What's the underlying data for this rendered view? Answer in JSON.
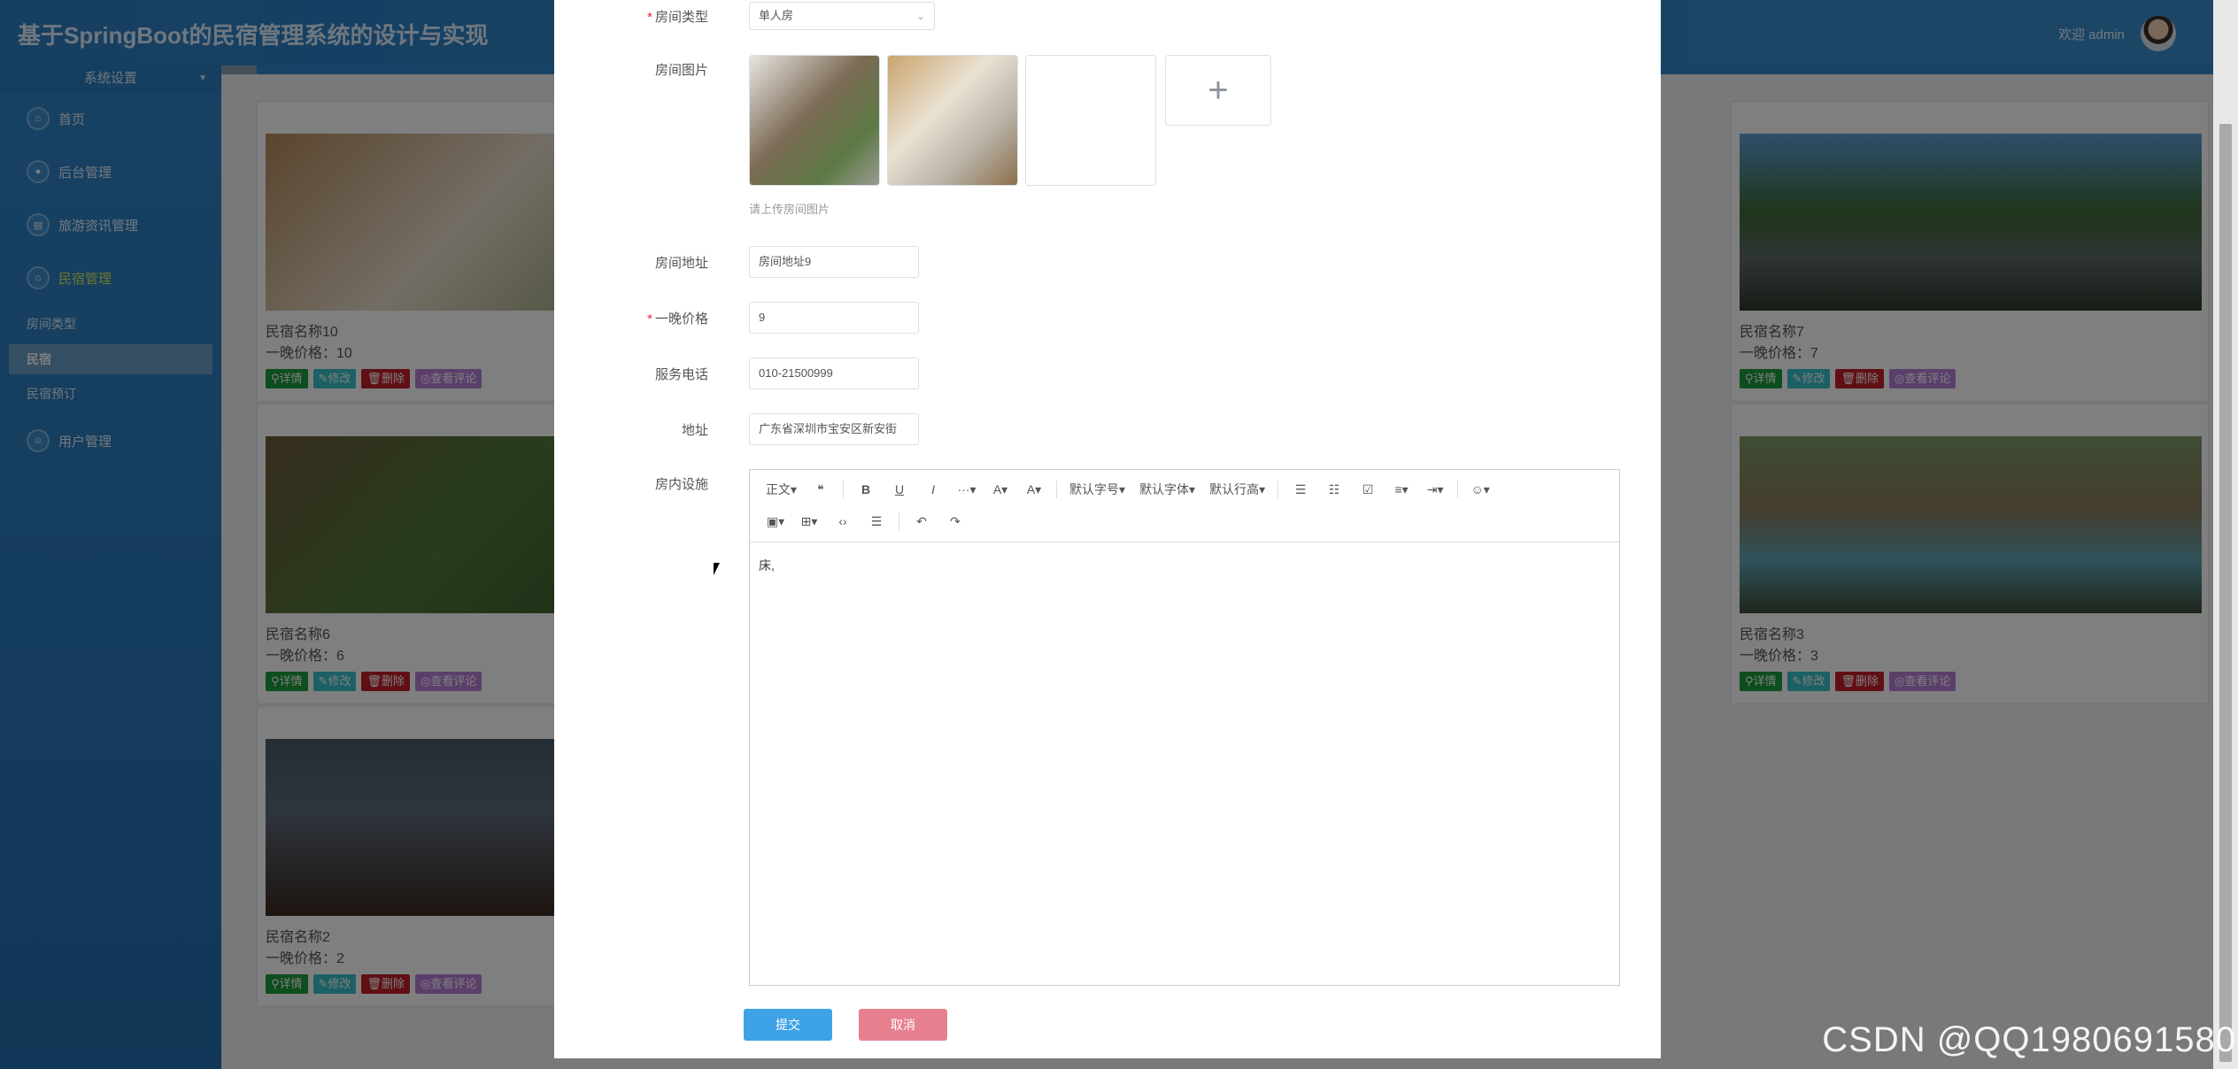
{
  "header": {
    "title": "基于SpringBoot的民宿管理系统的设计与实现",
    "welcome": "欢迎 admin"
  },
  "sidebar": {
    "section": "系统设置",
    "items": [
      {
        "label": "首页",
        "icon": "home-icon"
      },
      {
        "label": "后台管理",
        "icon": "admin-icon"
      },
      {
        "label": "旅游资讯管理",
        "icon": "news-icon"
      },
      {
        "label": "民宿管理",
        "icon": "homestay-icon"
      }
    ],
    "subitems": [
      "房间类型",
      "民宿",
      "民宿预订"
    ],
    "user_mgmt": "用户管理"
  },
  "cards": [
    {
      "name": "民宿名称10",
      "price": "一晚价格：10"
    },
    {
      "name": "民宿名称7",
      "price": "一晚价格：7"
    },
    {
      "name": "民宿名称6",
      "price": "一晚价格：6"
    },
    {
      "name": "民宿名称3",
      "price": "一晚价格：3"
    },
    {
      "name": "民宿名称2",
      "price": "一晚价格：2"
    }
  ],
  "card_buttons": {
    "detail": "详情",
    "edit": "修改",
    "delete": "删除",
    "comments": "查看评论"
  },
  "form": {
    "room_type": {
      "label": "房间类型",
      "value": "单人房"
    },
    "room_images": {
      "label": "房间图片",
      "tip": "请上传房间图片",
      "add": "+"
    },
    "room_address": {
      "label": "房间地址",
      "value": "房间地址9"
    },
    "price": {
      "label": "一晚价格",
      "value": "9"
    },
    "phone": {
      "label": "服务电话",
      "value": "010-21500999"
    },
    "address": {
      "label": "地址",
      "value": "广东省深圳市宝安区新安街"
    },
    "facilities": {
      "label": "房内设施",
      "content": "床,"
    }
  },
  "toolbar": {
    "row1": [
      "正文▾",
      "❝",
      "B",
      "U",
      "I",
      "···▾",
      "A▾",
      "A▾",
      "默认字号▾",
      "默认字体▾",
      "默认行高▾",
      "☰",
      "☷",
      "☑",
      "≡▾",
      "⇥▾",
      "☺▾"
    ],
    "row2": [
      "▣▾",
      "⊞▾",
      "‹›",
      "☰",
      "↶",
      "↷"
    ]
  },
  "footer": {
    "submit": "提交",
    "cancel": "取消"
  },
  "watermark": "CSDN @QQ1980691580"
}
